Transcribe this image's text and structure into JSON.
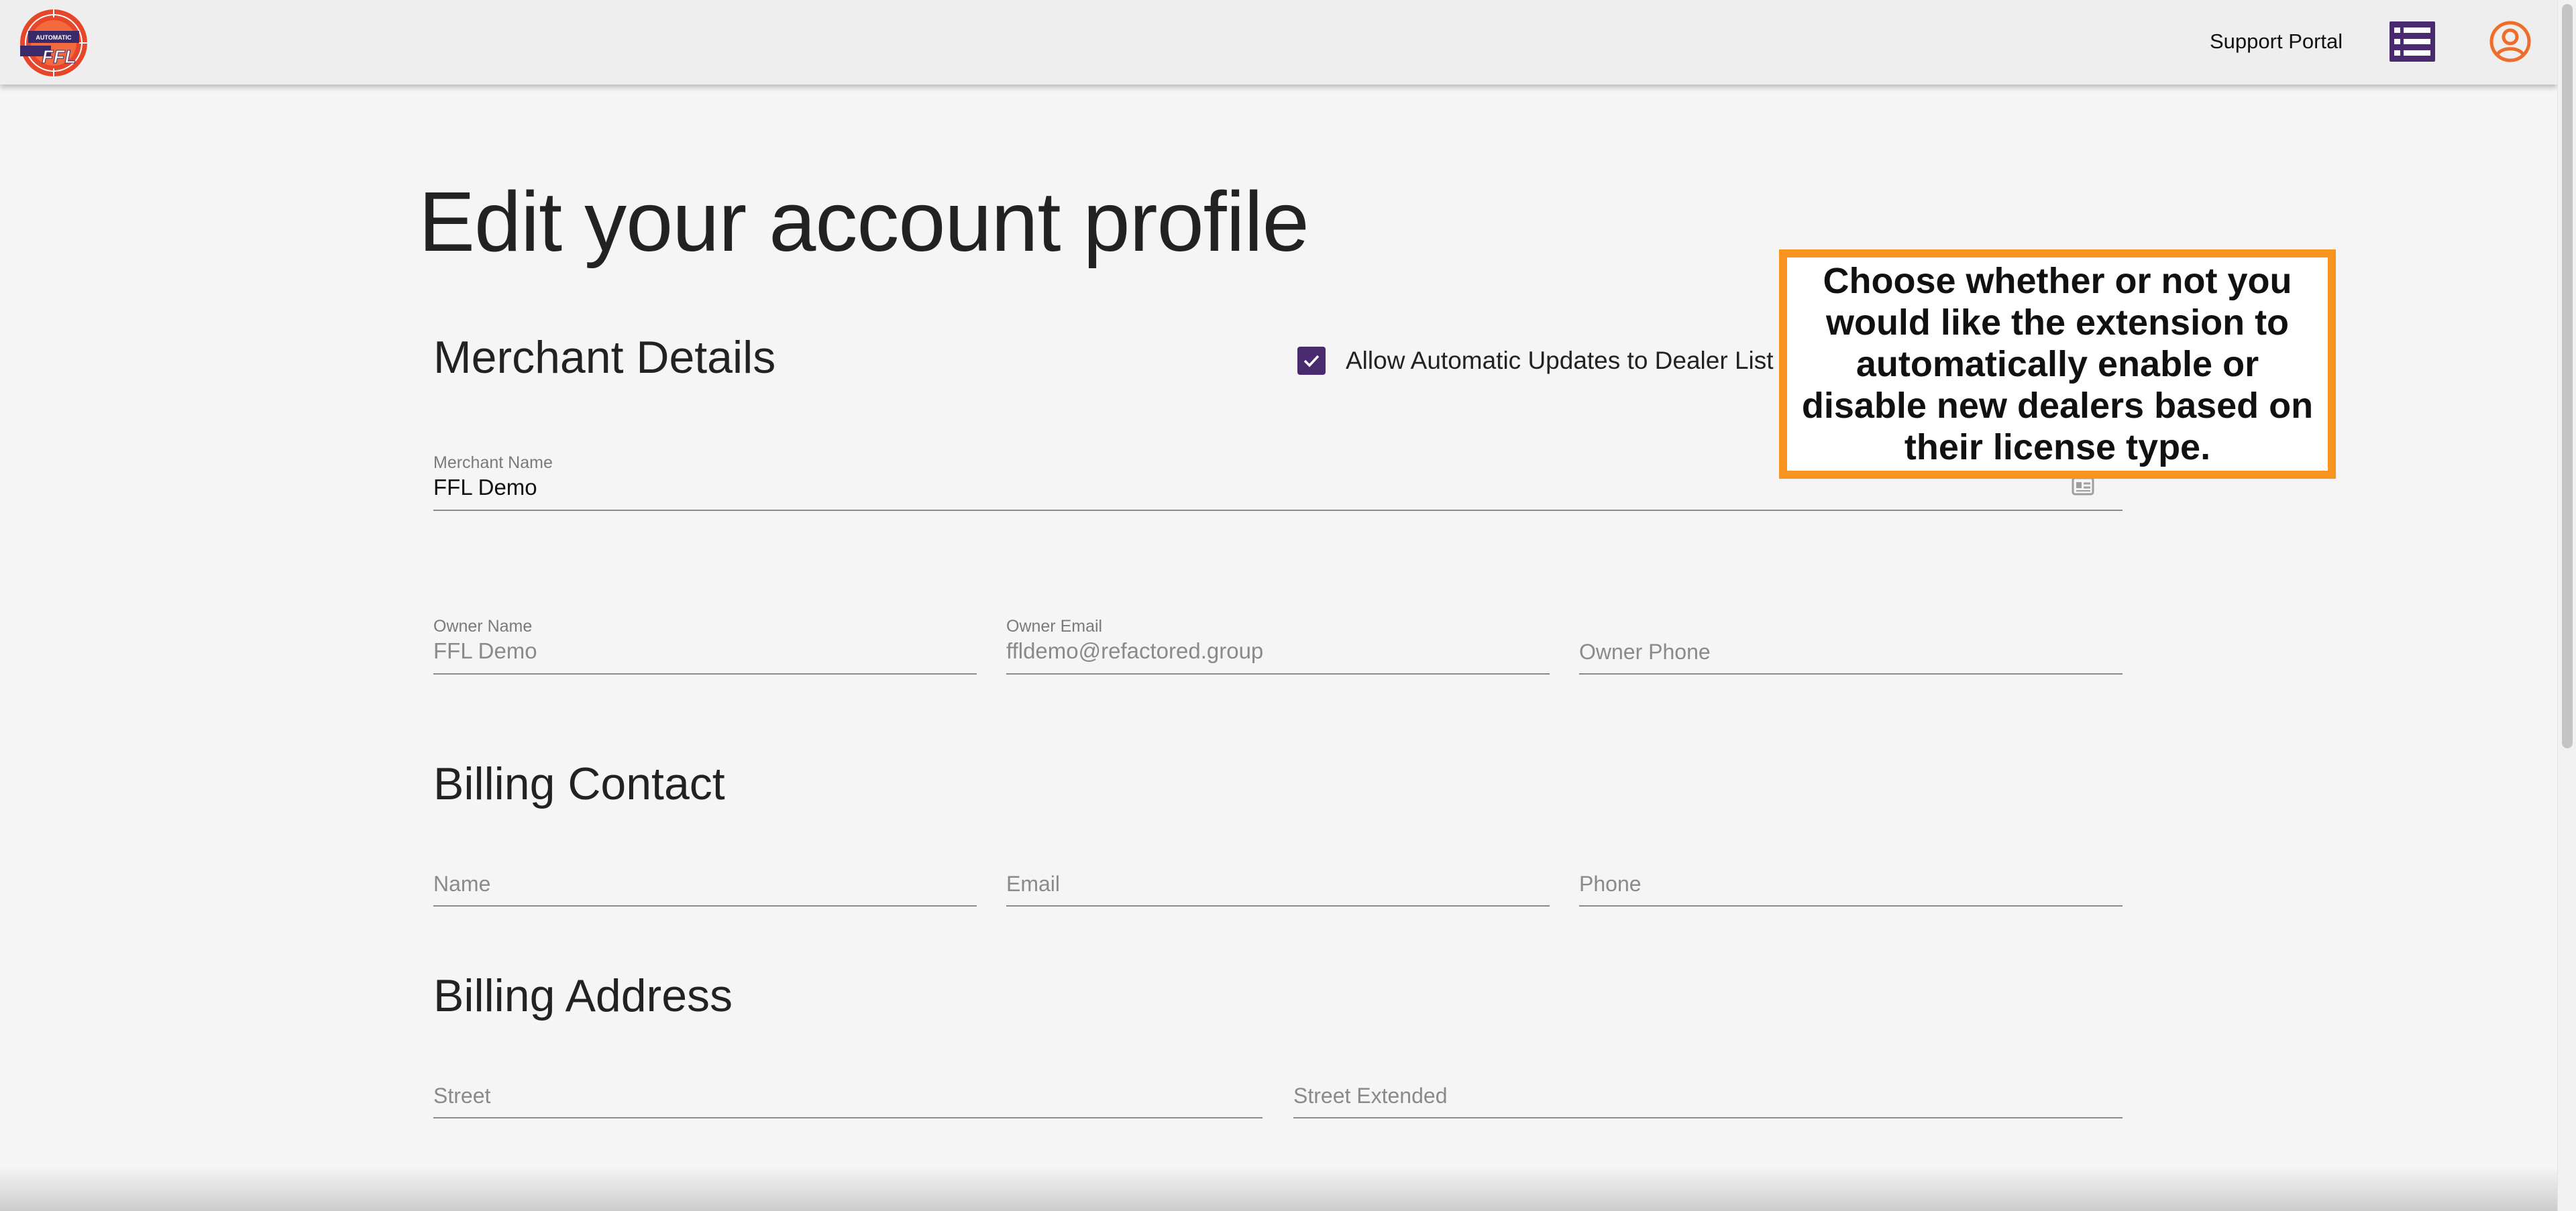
{
  "header": {
    "logo_icon": "automatic-ffl-logo-icon",
    "logo_text": "AUTOMATIC FFL",
    "support_label": "Support Portal",
    "menu_icon": "list-icon",
    "account_icon": "account-circle-icon",
    "accent_color": "#4a2a6e",
    "account_color": "#ef6c2a"
  },
  "page": {
    "title": "Edit your account profile"
  },
  "merchant": {
    "section_title": "Merchant Details",
    "auto_update_label": "Allow Automatic Updates to Dealer List",
    "auto_update_checked": true,
    "merchant_name_label": "Merchant Name",
    "merchant_name_value": "FFL Demo",
    "merchant_name_icon": "id-card-icon",
    "owner_name_label": "Owner Name",
    "owner_name_value": "FFL Demo",
    "owner_email_label": "Owner Email",
    "owner_email_value": "ffldemo@refactored.group",
    "owner_phone_placeholder": "Owner Phone"
  },
  "billing_contact": {
    "section_title": "Billing Contact",
    "name_placeholder": "Name",
    "email_placeholder": "Email",
    "phone_placeholder": "Phone"
  },
  "billing_address": {
    "section_title": "Billing Address",
    "street_placeholder": "Street",
    "street_ext_placeholder": "Street Extended"
  },
  "callout": {
    "text": "Choose whether or not you would like the extension to automatically enable or disable new dealers based on their license type.",
    "border_color": "#f7931e"
  }
}
